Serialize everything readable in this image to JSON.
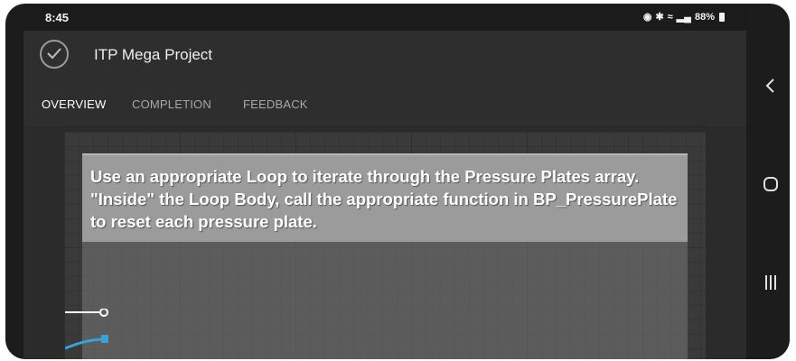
{
  "status_bar": {
    "time": "8:45",
    "battery": "88%"
  },
  "app_bar": {
    "title": "ITP Mega Project"
  },
  "tabs": [
    {
      "label": "OVERVIEW",
      "active": true
    },
    {
      "label": "COMPLETION",
      "active": false
    },
    {
      "label": "FEEDBACK",
      "active": false
    }
  ],
  "comment": {
    "text": "Use an appropriate Loop to iterate through the Pressure Plates array.  \"Inside\" the Loop Body, call the appropriate function in BP_PressurePlate to reset each pressure plate."
  },
  "colors": {
    "wire_white": "#ffffff",
    "wire_blue": "#3aa0d8"
  },
  "icons": {
    "check": "check-icon",
    "back": "back-nav-icon",
    "home": "home-nav-icon",
    "recents": "recents-nav-icon"
  }
}
